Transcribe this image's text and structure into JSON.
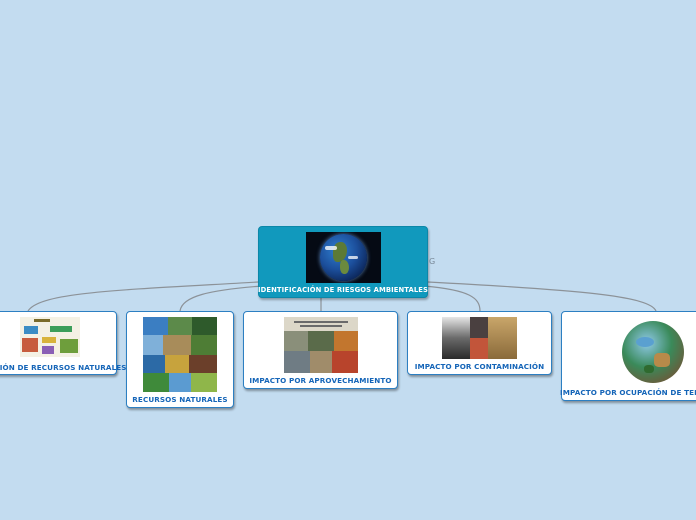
{
  "root": {
    "label": "IDENTIFICACIÓN DE RIESGOS AMBIENTALES",
    "image": "globe-earth-icon"
  },
  "side_glyph": "G",
  "children": [
    {
      "id": "recursos-naturales-gestion",
      "label": "GESTIÓN DE RECURSOS NATURALES",
      "image": "resource-infographic-icon"
    },
    {
      "id": "recursos-naturales",
      "label": "RECURSOS NATURALES",
      "image": "nature-collage-icon"
    },
    {
      "id": "impacto-aprovechamiento",
      "label": "IMPACTO POR APROVECHAMIENTO",
      "image": "exploitation-collage-icon"
    },
    {
      "id": "impacto-contaminacion",
      "label": "IMPACTO POR CONTAMINACIÓN",
      "image": "pollution-collage-icon"
    },
    {
      "id": "impacto-ocupacion",
      "label": "IMPACTO POR OCUPACIÓN DE TERRITORIO",
      "image": "territory-globe-icon"
    }
  ],
  "colors": {
    "background": "#c3dcf0",
    "root_fill": "#1199bd",
    "node_border": "#2c7fc2",
    "node_label": "#1565b8",
    "connector": "#8c9298"
  }
}
